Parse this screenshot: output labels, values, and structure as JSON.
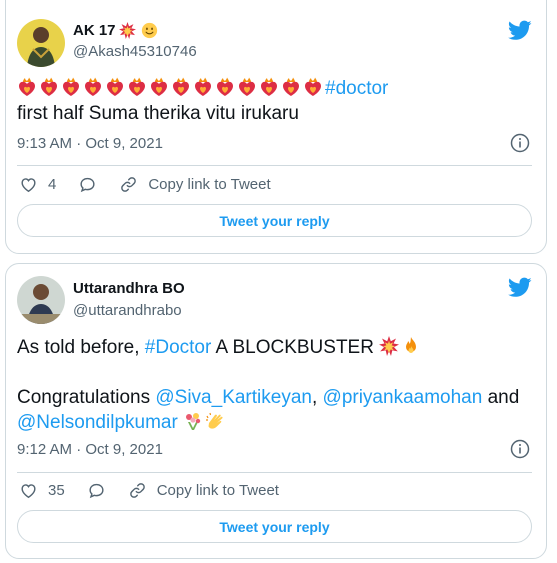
{
  "tweets": [
    {
      "author_name": "AK 17",
      "handle": "@Akash45310746",
      "name_emojis": [
        "collision-emoji",
        "smile-emoji"
      ],
      "text_emoji_count": 14,
      "hashtag": "#doctor",
      "text_line2": "first half Suma therika vitu irukaru",
      "timestamp": "9:13 AM · Oct 9, 2021",
      "like_count": "4",
      "copy_link_label": "Copy link to Tweet",
      "reply_label": "Tweet your reply"
    },
    {
      "author_name": "Uttarandhra BO",
      "handle": "@uttarandhrabo",
      "text_prefix": "As told before, ",
      "hashtag": "#Doctor",
      "text_suffix": " A BLOCKBUSTER ",
      "congrats": "Congratulations ",
      "mention1": "@Siva_Kartikeyan",
      "comma": ", ",
      "mention2": "@priyankaamohan",
      "and_text": " and",
      "mention3": "@Nelsondilpkumar",
      "timestamp": "9:12 AM · Oct 9, 2021",
      "like_count": "35",
      "copy_link_label": "Copy link to Tweet",
      "reply_label": "Tweet your reply"
    }
  ],
  "colors": {
    "twitter_blue": "#1d9bf0",
    "text": "#0f1419",
    "muted": "#536471",
    "border": "#cfd9de"
  }
}
